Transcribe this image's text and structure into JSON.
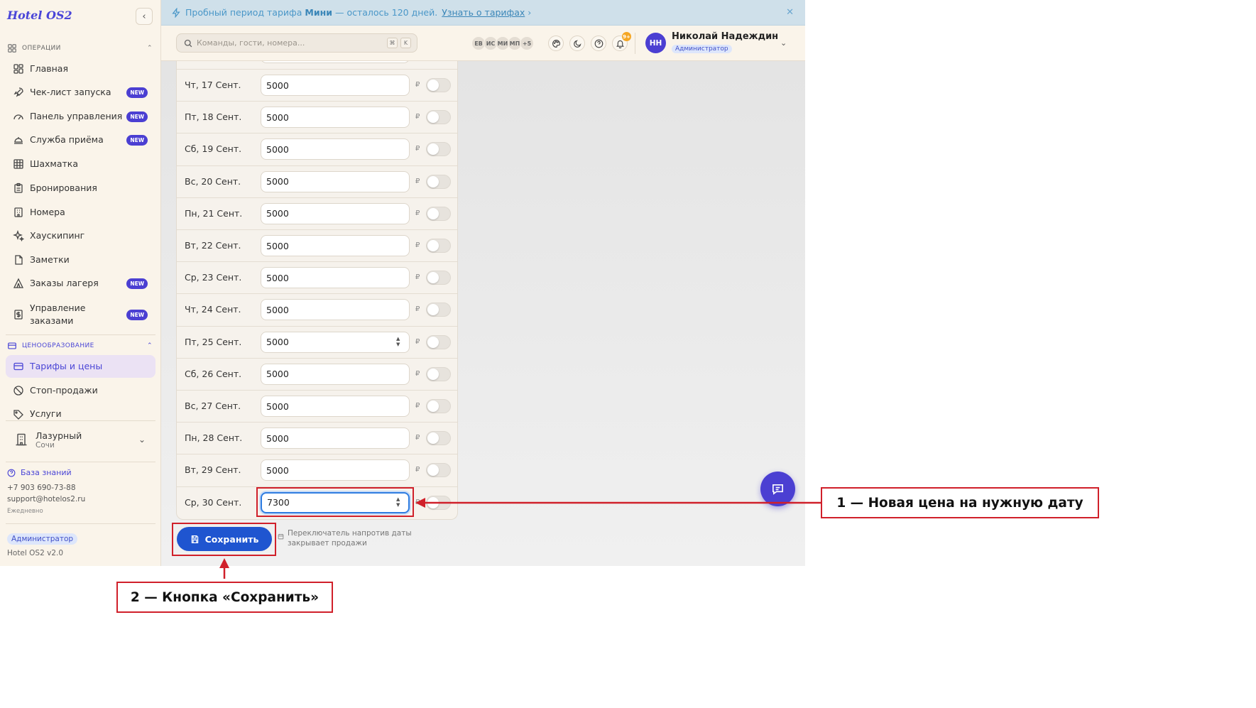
{
  "app": {
    "logo": "Hotel OS2"
  },
  "sidebar": {
    "collapse_glyph": "‹",
    "sections": {
      "operations": "ОПЕРАЦИИ",
      "pricing": "ЦЕНООБРАЗОВАНИЕ"
    },
    "items": [
      {
        "label": "Главная",
        "icon": "grid-icon"
      },
      {
        "label": "Чек-лист запуска",
        "icon": "rocket-icon",
        "badge": "NEW"
      },
      {
        "label": "Панель управления",
        "icon": "gauge-icon",
        "badge": "NEW"
      },
      {
        "label": "Служба приёма",
        "icon": "bell-desk-icon",
        "badge": "NEW"
      },
      {
        "label": "Шахматка",
        "icon": "table-grid-icon"
      },
      {
        "label": "Бронирования",
        "icon": "clipboard-icon"
      },
      {
        "label": "Номера",
        "icon": "building-icon"
      },
      {
        "label": "Хаускипинг",
        "icon": "sparkles-icon"
      },
      {
        "label": "Заметки",
        "icon": "file-icon"
      },
      {
        "label": "Заказы лагеря",
        "icon": "tent-icon",
        "badge": "NEW"
      },
      {
        "label": "Управление заказами",
        "icon": "dollar-doc-icon",
        "badge": "NEW"
      }
    ],
    "pricing_items": [
      {
        "label": "Тарифы и цены",
        "icon": "card-icon",
        "active": true
      },
      {
        "label": "Стоп-продажи",
        "icon": "ban-icon"
      },
      {
        "label": "Услуги",
        "icon": "tag-icon"
      }
    ],
    "hotel": {
      "name": "Лазурный",
      "city": "Сочи"
    },
    "knowledge_base": "База знаний",
    "phone": "+7 903 690-73-88",
    "email": "support@hotelos2.ru",
    "schedule": "Ежедневно",
    "role": "Администратор",
    "version": "Hotel OS2 v2.0"
  },
  "banner": {
    "text_before": "Пробный период тарифа",
    "plan": "Мини",
    "text_after": "— осталось 120 дней.",
    "link": "Узнать о тарифах",
    "colors": {
      "background": "#cfe0ea",
      "text": "#4a97c8"
    }
  },
  "header": {
    "search": {
      "placeholder": "Команды, гости, номера...",
      "value": "",
      "kbd": [
        "⌘",
        "K"
      ]
    },
    "avatars": [
      "ЕВ",
      "ИС",
      "МИ",
      "МП",
      "+5"
    ],
    "notifications": "9+",
    "user": {
      "initials": "НН",
      "name": "Николай Надеждин",
      "role": "Администратор"
    }
  },
  "prices": {
    "currency": "₽",
    "rows": [
      {
        "date": "Чт, 17 Сент.",
        "value": "5000",
        "stop_sale": false
      },
      {
        "date": "Пт, 18 Сент.",
        "value": "5000",
        "stop_sale": false
      },
      {
        "date": "Сб, 19 Сент.",
        "value": "5000",
        "stop_sale": false
      },
      {
        "date": "Вс, 20 Сент.",
        "value": "5000",
        "stop_sale": false
      },
      {
        "date": "Пн, 21 Сент.",
        "value": "5000",
        "stop_sale": false
      },
      {
        "date": "Вт, 22 Сент.",
        "value": "5000",
        "stop_sale": false
      },
      {
        "date": "Ср, 23 Сент.",
        "value": "5000",
        "stop_sale": false
      },
      {
        "date": "Чт, 24 Сент.",
        "value": "5000",
        "stop_sale": false
      },
      {
        "date": "Пт, 25 Сент.",
        "value": "5000",
        "stop_sale": false,
        "spinner": true
      },
      {
        "date": "Сб, 26 Сент.",
        "value": "5000",
        "stop_sale": false
      },
      {
        "date": "Вс, 27 Сент.",
        "value": "5000",
        "stop_sale": false
      },
      {
        "date": "Пн, 28 Сент.",
        "value": "5000",
        "stop_sale": false
      },
      {
        "date": "Вт, 29 Сент.",
        "value": "5000",
        "stop_sale": false
      },
      {
        "date": "Ср, 30 Сент.",
        "value": "7300",
        "stop_sale": false,
        "spinner": true,
        "focused": true
      }
    ]
  },
  "actions": {
    "save": "Сохранить",
    "hint": "Переключатель напротив даты закрывает продажи"
  },
  "annotations": {
    "callout_1": "1 — Новая цена на нужную дату",
    "callout_2": "2 — Кнопка «Сохранить»",
    "color": "#d0202a"
  },
  "colors": {
    "accent": "#4b3fd2",
    "primary_button": "#1f55d0",
    "sidebar_bg": "#faf4ea"
  }
}
